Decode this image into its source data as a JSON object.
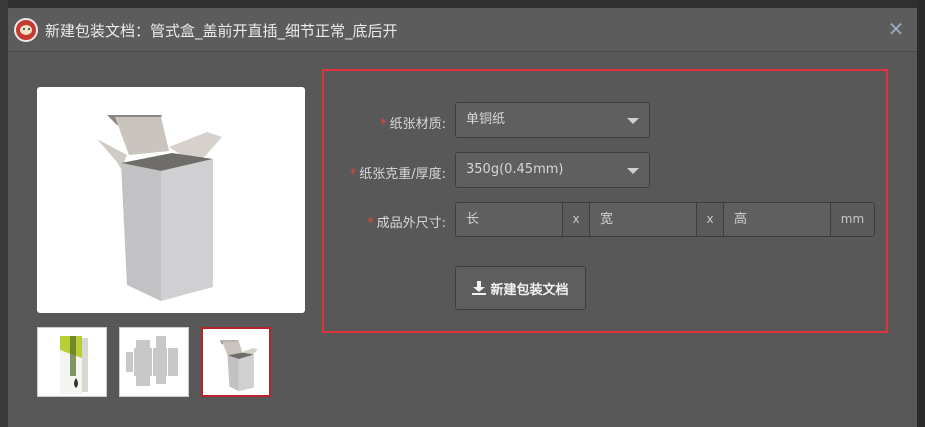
{
  "dialog": {
    "title": "新建包装文档：管式盒_盖前开直插_细节正常_底后开",
    "close_symbol": "✕",
    "logo_icon": "monkey-logo-icon"
  },
  "form": {
    "material": {
      "label": "纸张材质:",
      "value": "单铜纸",
      "required_mark": "*"
    },
    "weight": {
      "label": "纸张克重/厚度:",
      "value": "350g(0.45mm)",
      "required_mark": "*"
    },
    "size": {
      "label": "成品外尺寸:",
      "required_mark": "*",
      "length_placeholder": "长",
      "width_placeholder": "宽",
      "height_placeholder": "高",
      "separator": "x",
      "unit": "mm"
    },
    "create_button": {
      "label": "新建包装文档",
      "icon": "download-icon"
    }
  },
  "thumbnails": [
    {
      "name": "product-print-thumbnail"
    },
    {
      "name": "dieline-thumbnail"
    },
    {
      "name": "3d-box-thumbnail",
      "selected": true
    }
  ],
  "colors": {
    "accent_red": "#e2323b",
    "required_star": "#e34a3c",
    "dialog_bg": "#585858"
  }
}
